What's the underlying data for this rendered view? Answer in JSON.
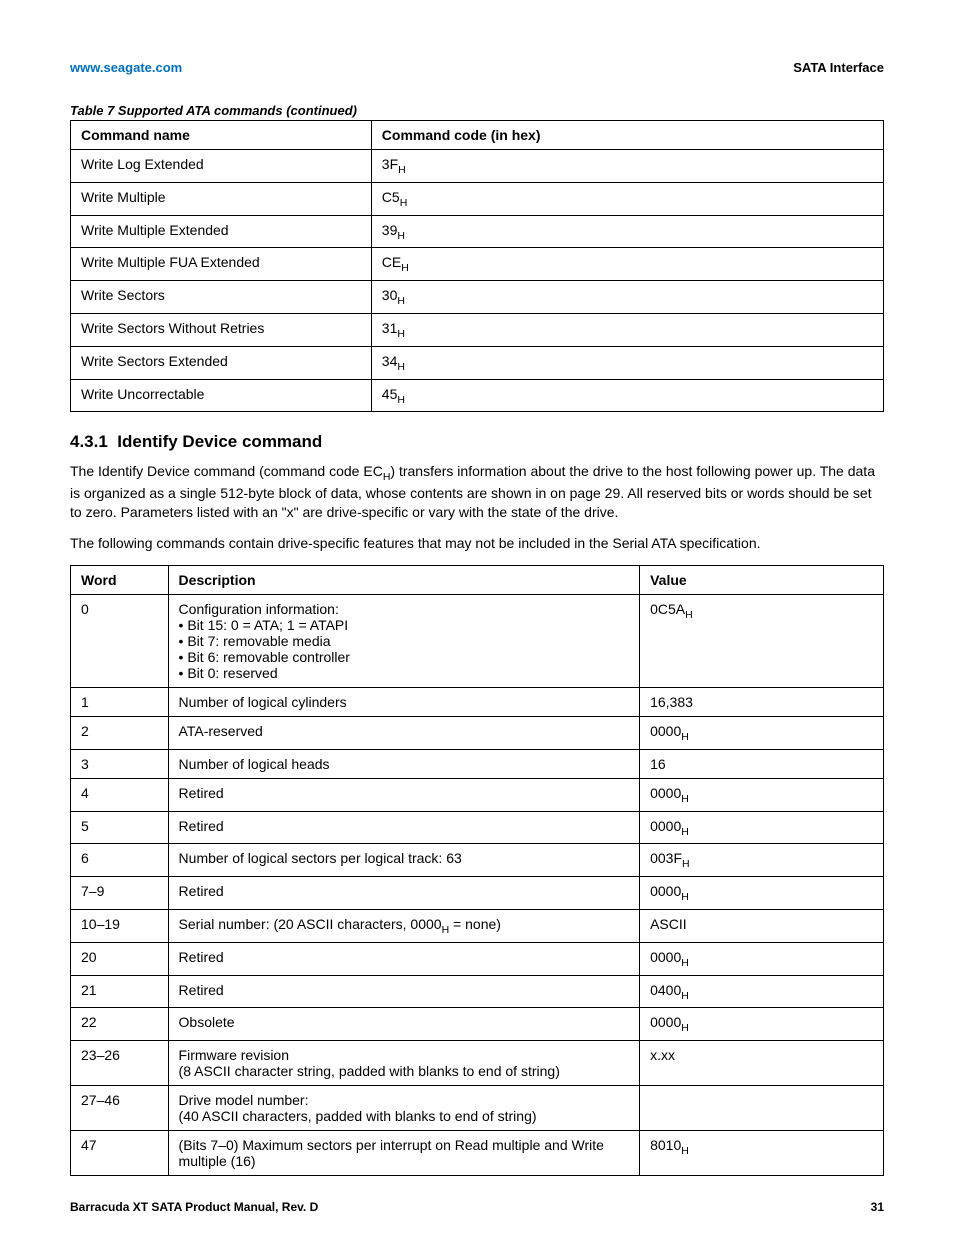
{
  "header": {
    "link": "www.seagate.com",
    "right": "SATA Interface"
  },
  "table1": {
    "caption": "Table 7   Supported ATA commands  (continued)",
    "headers": [
      "Command name",
      "Command code (in hex)"
    ],
    "rows": [
      {
        "name": "Write Log Extended",
        "code": "3F",
        "sub": "H"
      },
      {
        "name": "Write Multiple",
        "code": "C5",
        "sub": "H"
      },
      {
        "name": "Write Multiple Extended",
        "code": "39",
        "sub": "H"
      },
      {
        "name": "Write Multiple FUA Extended",
        "code": "CE",
        "sub": "H"
      },
      {
        "name": "Write Sectors",
        "code": "30",
        "sub": "H"
      },
      {
        "name": "Write Sectors Without Retries",
        "code": "31",
        "sub": "H"
      },
      {
        "name": "Write Sectors Extended",
        "code": "34",
        "sub": "H"
      },
      {
        "name": "Write Uncorrectable",
        "code": "45",
        "sub": "H"
      }
    ]
  },
  "section": {
    "num": "4.3.1",
    "title": "Identify Device command"
  },
  "para1": {
    "pre": "The Identify Device command (command code EC",
    "sub": "H",
    "post": ") transfers information about the drive to the host following power up. The data is organized as a single 512-byte block of data, whose contents are shown in  on page 29. All reserved bits or words should be set to zero. Parameters listed with an \"x\" are drive-specific or vary with the state of the drive."
  },
  "para2": "The following commands contain drive-specific features that may not be included in the Serial ATA specification.",
  "table2": {
    "headers": [
      "Word",
      "Description",
      "Value"
    ],
    "rows": [
      {
        "word": "0",
        "desc_lines": [
          "Configuration information:",
          "• Bit 15: 0 = ATA; 1 = ATAPI",
          "• Bit 7: removable media",
          "• Bit 6: removable controller",
          "• Bit 0: reserved"
        ],
        "val": "0C5A",
        "val_sub": "H"
      },
      {
        "word": "1",
        "desc_lines": [
          "Number of logical cylinders"
        ],
        "val": "16,383"
      },
      {
        "word": "2",
        "desc_lines": [
          "ATA-reserved"
        ],
        "val": "0000",
        "val_sub": "H"
      },
      {
        "word": "3",
        "desc_lines": [
          "Number of logical heads"
        ],
        "val": "16"
      },
      {
        "word": "4",
        "desc_lines": [
          "Retired"
        ],
        "val": "0000",
        "val_sub": "H"
      },
      {
        "word": "5",
        "desc_lines": [
          "Retired"
        ],
        "val": "0000",
        "val_sub": "H"
      },
      {
        "word": "6",
        "desc_lines": [
          "Number of logical sectors per logical track: 63"
        ],
        "val": "003F",
        "val_sub": "H"
      },
      {
        "word": "7–9",
        "desc_lines": [
          "Retired"
        ],
        "val": "0000",
        "val_sub": "H"
      },
      {
        "word": "10–19",
        "desc_pre": "Serial number: (20 ASCII characters, 0000",
        "desc_sub": "H",
        "desc_post": " = none)",
        "val": "ASCII"
      },
      {
        "word": "20",
        "desc_lines": [
          "Retired"
        ],
        "val": "0000",
        "val_sub": "H"
      },
      {
        "word": "21",
        "desc_lines": [
          "Retired"
        ],
        "val": "0400",
        "val_sub": "H"
      },
      {
        "word": "22",
        "desc_lines": [
          "Obsolete"
        ],
        "val": "0000",
        "val_sub": "H"
      },
      {
        "word": "23–26",
        "desc_lines": [
          "Firmware revision",
          "(8 ASCII character string, padded with blanks to end of string)"
        ],
        "val": "x.xx"
      },
      {
        "word": "27–46",
        "desc_lines": [
          "Drive model number:",
          "(40 ASCII characters, padded with blanks to end of string)"
        ],
        "val": ""
      },
      {
        "word": "47",
        "desc_lines": [
          "(Bits 7–0) Maximum sectors per interrupt on Read multiple and Write multiple (16)"
        ],
        "val": "8010",
        "val_sub": "H"
      }
    ]
  },
  "footer": {
    "left": "Barracuda XT SATA Product Manual, Rev. D",
    "right": "31"
  }
}
